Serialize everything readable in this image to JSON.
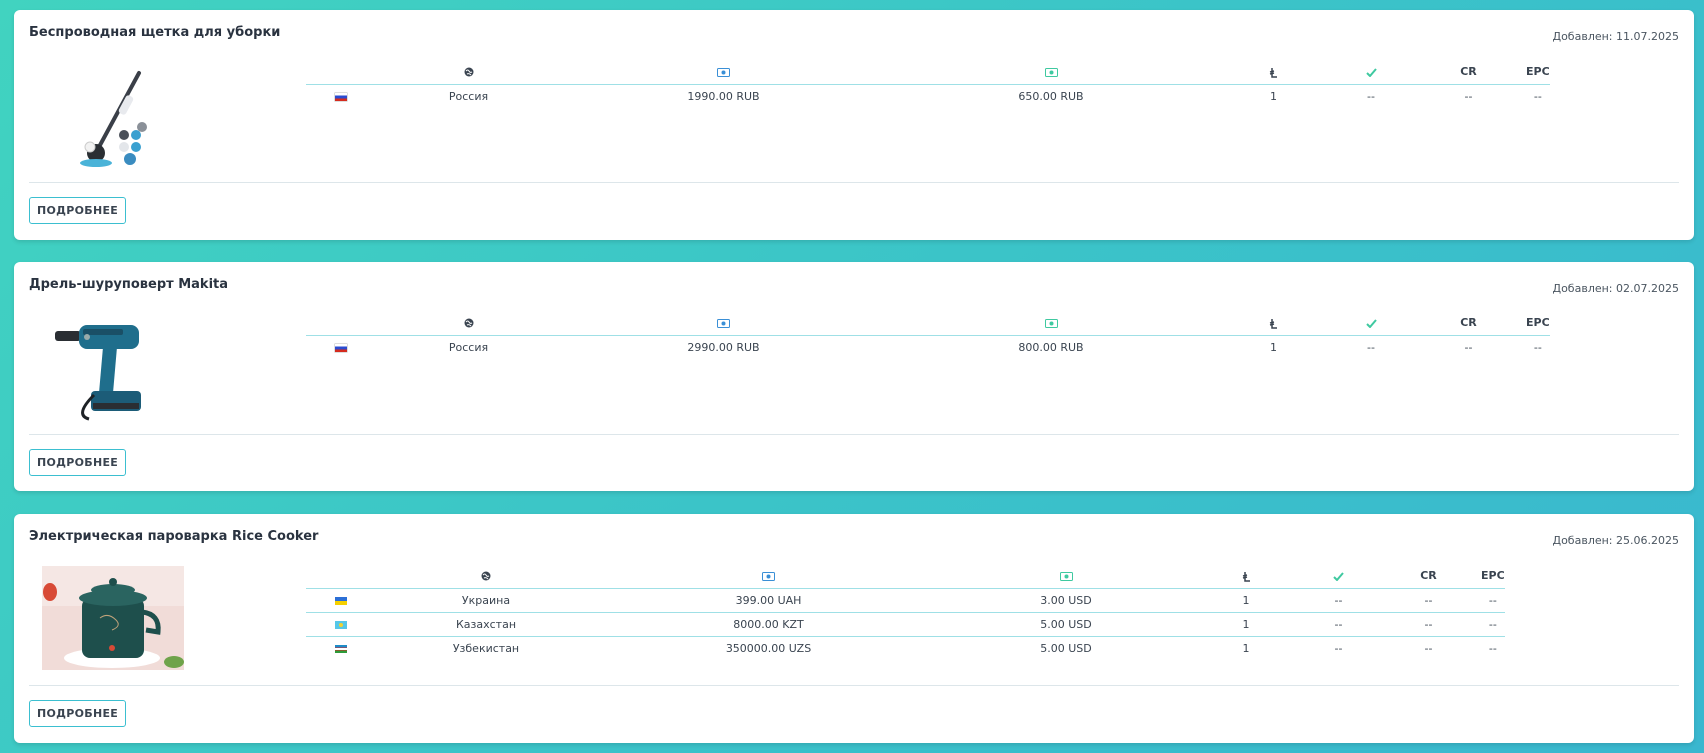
{
  "columns": {
    "globe_icon": "globe-icon",
    "price_icon": "money-icon",
    "payout_icon": "money-icon",
    "time_icon": "lira-icon",
    "approve_icon": "check-icon",
    "cr": "CR",
    "epc": "EPC"
  },
  "more_label": "ПОДРОБНЕЕ",
  "cards": [
    {
      "title": "Беспроводная щетка для уборки",
      "date": "Добавлен: 11.07.2025",
      "rows": [
        {
          "flag": "ru",
          "country": "Россия",
          "price": "1990.00 RUB",
          "payout": "650.00 RUB",
          "hold": "1",
          "approve": "--",
          "cr": "--",
          "epc": "--"
        }
      ]
    },
    {
      "title": "Дрель-шуруповерт Makita",
      "date": "Добавлен: 02.07.2025",
      "rows": [
        {
          "flag": "ru",
          "country": "Россия",
          "price": "2990.00 RUB",
          "payout": "800.00 RUB",
          "hold": "1",
          "approve": "--",
          "cr": "--",
          "epc": "--"
        }
      ]
    },
    {
      "title": "Электрическая пароварка Rice Cooker",
      "date": "Добавлен: 25.06.2025",
      "rows": [
        {
          "flag": "ua",
          "country": "Украина",
          "price": "399.00 UAH",
          "payout": "3.00 USD",
          "hold": "1",
          "approve": "--",
          "cr": "--",
          "epc": "--"
        },
        {
          "flag": "kz",
          "country": "Казахстан",
          "price": "8000.00 KZT",
          "payout": "5.00 USD",
          "hold": "1",
          "approve": "--",
          "cr": "--",
          "epc": "--"
        },
        {
          "flag": "uz",
          "country": "Узбекистан",
          "price": "350000.00 UZS",
          "payout": "5.00 USD",
          "hold": "1",
          "approve": "--",
          "cr": "--",
          "epc": "--"
        }
      ]
    }
  ],
  "colors": {
    "accent": "#3bbfd0",
    "price_icon": "#3a8fd6",
    "payout_icon": "#3fc9a0",
    "check": "#3fc9a0"
  }
}
